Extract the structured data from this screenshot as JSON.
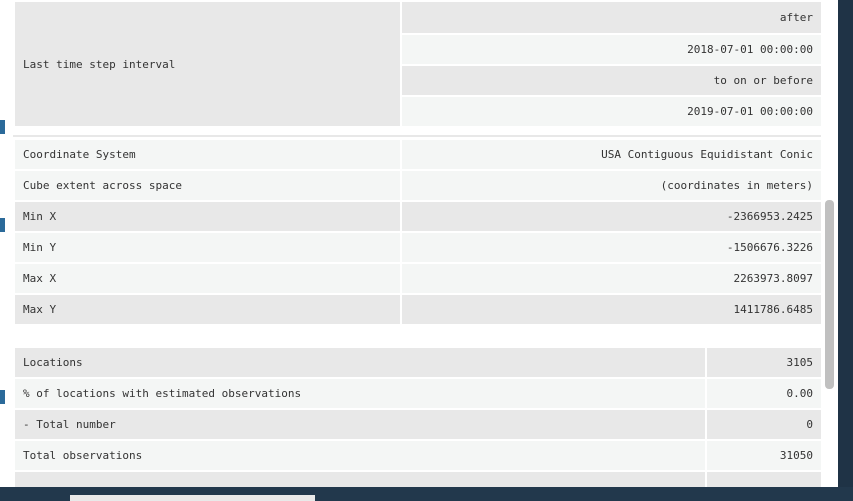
{
  "colors": {
    "row_dark": "#e8e8e8",
    "row_light": "#f4f6f5",
    "text": "#333333",
    "background": "#1f3346",
    "scroll_thumb": "#c0c0c0"
  },
  "time_interval": {
    "label": "Last time step interval",
    "values": [
      "after",
      "2018-07-01 00:00:00",
      "to on or before",
      "2019-07-01 00:00:00"
    ]
  },
  "spatial": {
    "rows": [
      {
        "label": "Coordinate System",
        "value": "USA Contiguous Equidistant Conic"
      },
      {
        "label": "Cube extent across space",
        "value": "(coordinates in meters)"
      },
      {
        "label": "Min X",
        "value": "-2366953.2425"
      },
      {
        "label": "Min Y",
        "value": "-1506676.3226"
      },
      {
        "label": "Max X",
        "value": "2263973.8097"
      },
      {
        "label": "Max Y",
        "value": "1411786.6485"
      }
    ]
  },
  "locations": {
    "rows": [
      {
        "label": "Locations",
        "value": "3105"
      },
      {
        "label": "% of locations with estimated observations",
        "value": "0.00"
      },
      {
        "label": "- Total number",
        "value": "0"
      },
      {
        "label": "Total observations",
        "value": "31050"
      }
    ]
  }
}
